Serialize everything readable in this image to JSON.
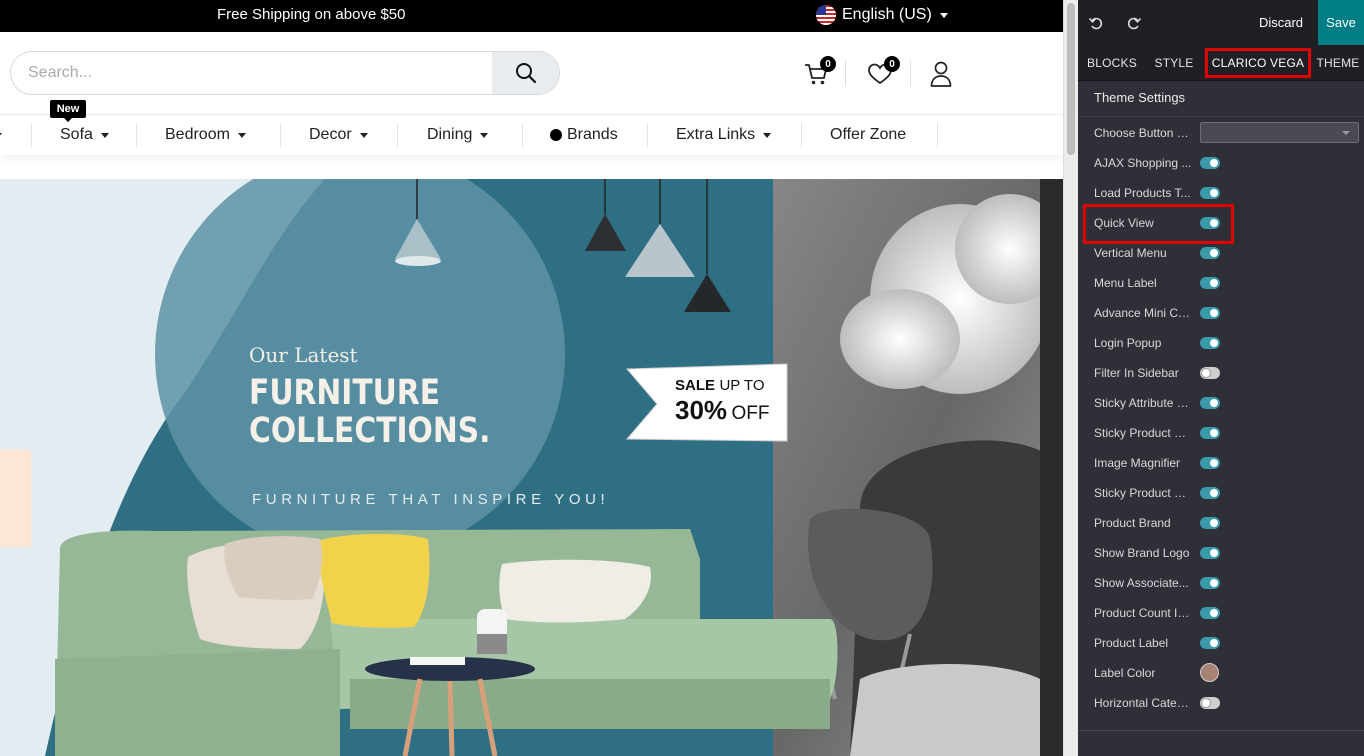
{
  "site": {
    "announcement": "Free Shipping on above $50",
    "language": "English (US)",
    "search": {
      "placeholder": "Search..."
    },
    "cart_count": "0",
    "wishlist_count": "0",
    "new_tag": "New",
    "menu": [
      {
        "label": "Sofa",
        "dropdown": true
      },
      {
        "label": "Bedroom",
        "dropdown": true
      },
      {
        "label": "Decor",
        "dropdown": true
      },
      {
        "label": "Dining",
        "dropdown": true
      },
      {
        "label": "Brands",
        "dropdown": false
      },
      {
        "label": "Extra Links",
        "dropdown": true
      },
      {
        "label": "Offer Zone",
        "dropdown": false
      }
    ],
    "banner": {
      "eyebrow": "Our Latest",
      "headline_1": "FURNITURE",
      "headline_2": "COLLECTIONS.",
      "tagline": "FURNITURE THAT INSPIRE YOU!",
      "sale_1": "SALE",
      "sale_2": "UP TO",
      "sale_3": "30%",
      "sale_4": "OFF"
    }
  },
  "panel": {
    "discard": "Discard",
    "save": "Save",
    "tabs": [
      "BLOCKS",
      "STYLE",
      "CLARICO VEGA",
      "THEME"
    ],
    "active_tab": "CLARICO VEGA",
    "section_title": "Theme Settings",
    "options": [
      {
        "label": "Choose Button S...",
        "control": "select"
      },
      {
        "label": "AJAX Shopping ...",
        "control": "toggle",
        "on": true
      },
      {
        "label": "Load Products T...",
        "control": "toggle",
        "on": true
      },
      {
        "label": "Quick View",
        "control": "toggle",
        "on": true,
        "highlighted": true
      },
      {
        "label": "Vertical Menu",
        "control": "toggle",
        "on": true
      },
      {
        "label": "Menu Label",
        "control": "toggle",
        "on": true
      },
      {
        "label": "Advance Mini Cart",
        "control": "toggle",
        "on": true
      },
      {
        "label": "Login Popup",
        "control": "toggle",
        "on": true
      },
      {
        "label": "Filter In Sidebar",
        "control": "toggle",
        "on": false
      },
      {
        "label": "Sticky Attribute &...",
        "control": "toggle",
        "on": true
      },
      {
        "label": "Sticky Product G...",
        "control": "toggle",
        "on": true
      },
      {
        "label": "Image Magnifier",
        "control": "toggle",
        "on": true
      },
      {
        "label": "Sticky Product D...",
        "control": "toggle",
        "on": true
      },
      {
        "label": "Product Brand",
        "control": "toggle",
        "on": true
      },
      {
        "label": "Show Brand Logo",
        "control": "toggle",
        "on": true
      },
      {
        "label": "Show Associate...",
        "control": "toggle",
        "on": true
      },
      {
        "label": "Product Count In...",
        "control": "toggle",
        "on": true
      },
      {
        "label": "Product Label",
        "control": "toggle",
        "on": true
      },
      {
        "label": "Label Color",
        "control": "color",
        "color": "#a88273"
      },
      {
        "label": "Horizontal Categ...",
        "control": "toggle",
        "on": false
      }
    ]
  },
  "colors": {
    "accent": "#017e84",
    "toggle_on": "#3b9bab",
    "highlight": "#e00000"
  }
}
